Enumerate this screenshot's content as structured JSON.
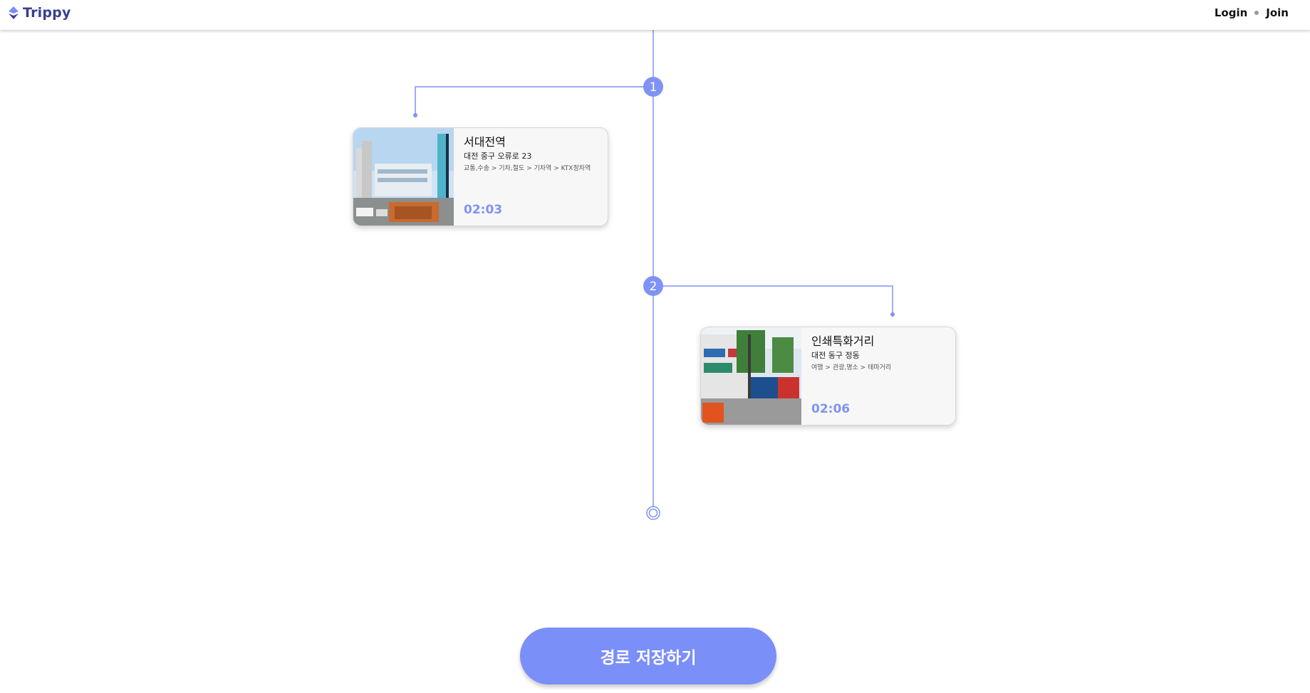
{
  "header": {
    "brand": "Trippy",
    "login_label": "Login",
    "join_label": "Join"
  },
  "route": {
    "stops": [
      {
        "number": "1",
        "name": "서대전역",
        "address": "대전 중구 오류로 23",
        "category": "교통,수송 > 기차,철도 > 기차역 > KTX정차역",
        "time": "02:03"
      },
      {
        "number": "2",
        "name": "인쇄특화거리",
        "address": "대전 동구 정동",
        "category": "여행 > 관광,명소 > 테마거리",
        "time": "02:06"
      }
    ]
  },
  "actions": {
    "save_route_label": "경로 저장하기"
  },
  "colors": {
    "accent": "#7b8ff8",
    "brand": "#3a3f8f",
    "line": "#7f93f5"
  },
  "icons": {
    "brand": "location-pin-icon",
    "end": "route-end-icon"
  }
}
